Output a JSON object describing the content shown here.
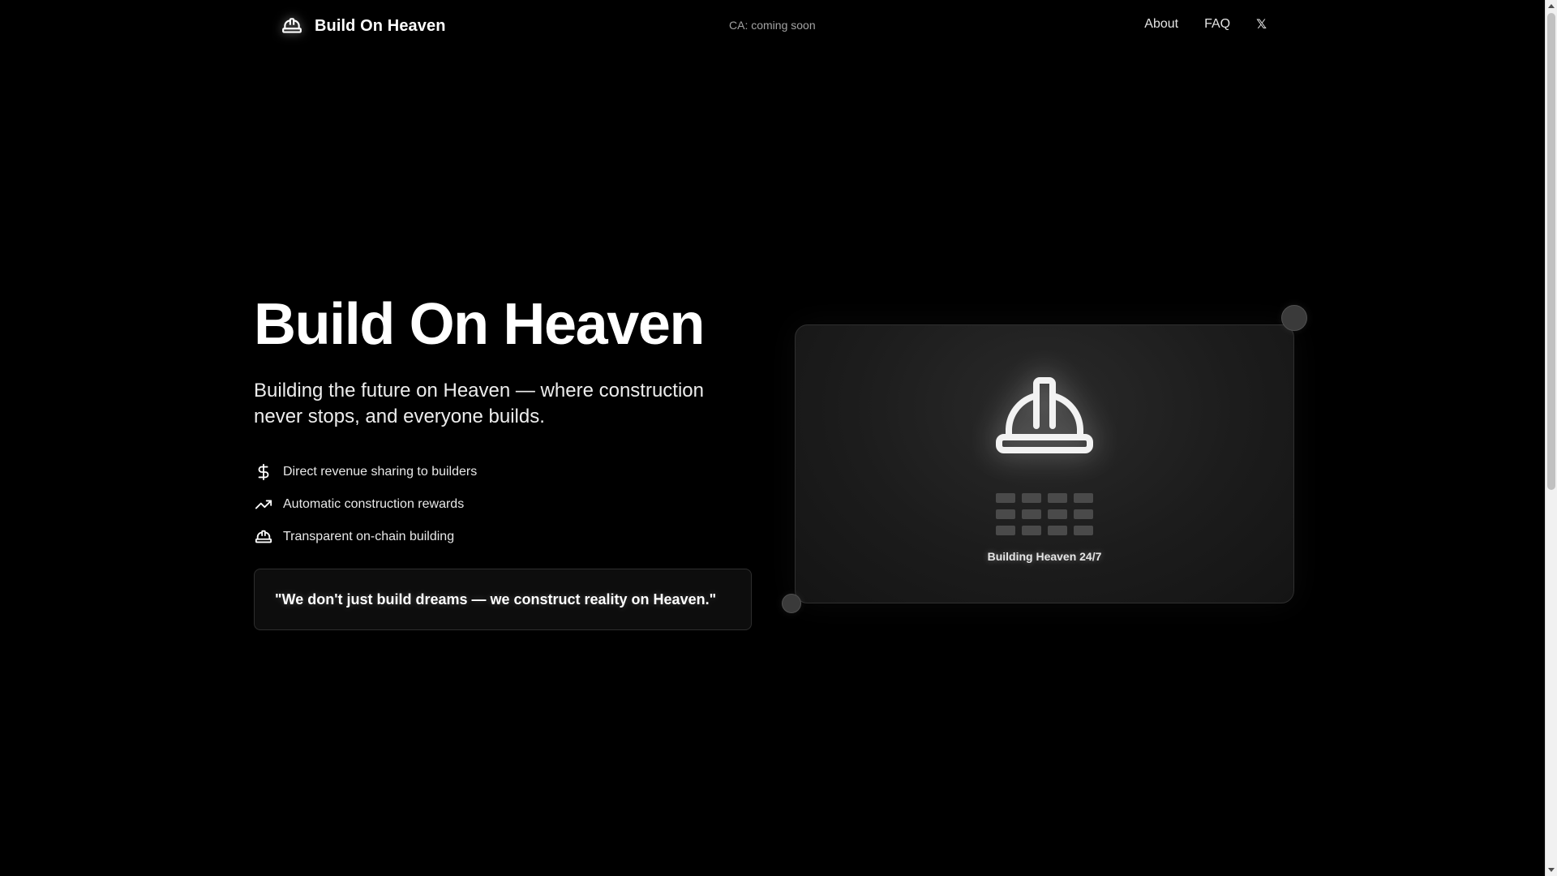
{
  "header": {
    "brand_name": "Build On Heaven",
    "brand_icon": "hard-hat-icon",
    "contract_address": "CA: coming soon",
    "nav": [
      {
        "label": "About"
      },
      {
        "label": "FAQ"
      },
      {
        "label": "𝕏",
        "icon": "x-logo-icon"
      }
    ]
  },
  "hero": {
    "title": "Build On Heaven",
    "subtitle": "Building the future on Heaven — where construction never stops, and everyone builds.",
    "features": [
      {
        "icon": "dollar-icon",
        "text": "Direct revenue sharing to builders"
      },
      {
        "icon": "trending-up-icon",
        "text": "Automatic construction rewards"
      },
      {
        "icon": "hard-hat-icon",
        "text": "Transparent on-chain building"
      }
    ],
    "quote": "\"We don't just build dreams — we construct reality on Heaven.\""
  },
  "card": {
    "icon": "hard-hat-icon",
    "label": "Building Heaven 24/7",
    "grid": {
      "rows": 3,
      "columns": 4
    }
  },
  "colors": {
    "background": "#000000",
    "text": "#ffffff",
    "muted": "#a3a3a3",
    "card": "#1c1c1c",
    "grid_block": "#4a4a4a"
  }
}
